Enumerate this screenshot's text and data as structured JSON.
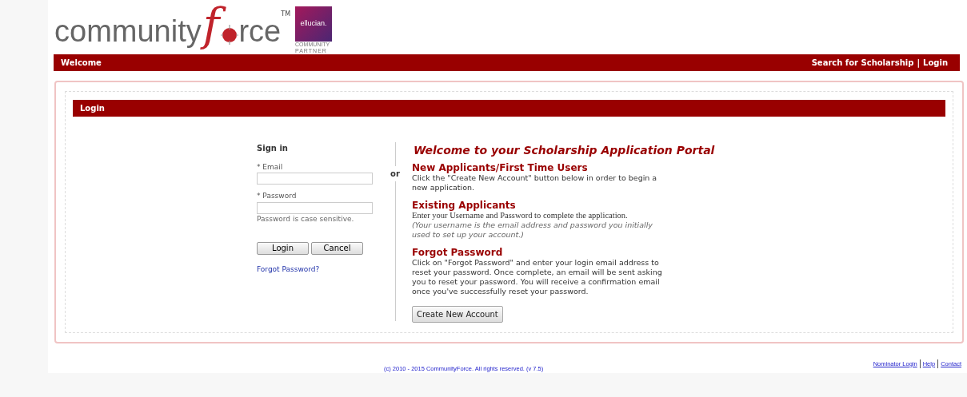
{
  "logo": {
    "word_start": "community",
    "letter": "f",
    "word_end": "rce",
    "mark": "TM",
    "partner_badge": "ellucian.",
    "partner_line_1": "COMMUNITY",
    "partner_line_2": "PARTNER"
  },
  "nav_bar": {
    "title": "Welcome",
    "links": [
      "Search for Scholarship",
      "Login"
    ],
    "separator": "|"
  },
  "panel": {
    "title": "Login"
  },
  "sign_in": {
    "heading": "Sign in",
    "fields": [
      {
        "label": "* Email"
      },
      {
        "label": "* Password",
        "hint": "Password is case sensitive."
      }
    ],
    "buttons": [
      "Login",
      "Cancel"
    ],
    "forgot_link": "Forgot Password?"
  },
  "divider_text": "or",
  "info": {
    "title": "Welcome to your Scholarship Application Portal",
    "sections": [
      {
        "heading": "New Applicants/First Time Users",
        "body": "Click the \"Create New Account\" button below in order to begin a new application."
      },
      {
        "heading": "Existing Applicants",
        "body": "Enter your Username and Password to complete the application.",
        "note": "(Your username is the email address and password you initially used to set up your account.)"
      },
      {
        "heading": "Forgot Password",
        "body": "Click on \"Forgot Password\"  and enter your login email address to reset your password. Once complete, an email will be sent asking you to reset your password. You will receive a confirmation email once you've successfully reset your password."
      }
    ],
    "button": "Create New Account"
  },
  "footer": {
    "copyright": "(c) 2010 - 2015 CommunityForce. All rights reserved. (v 7.5)",
    "links": [
      "Nominator Login",
      "Help",
      "Contact"
    ]
  }
}
